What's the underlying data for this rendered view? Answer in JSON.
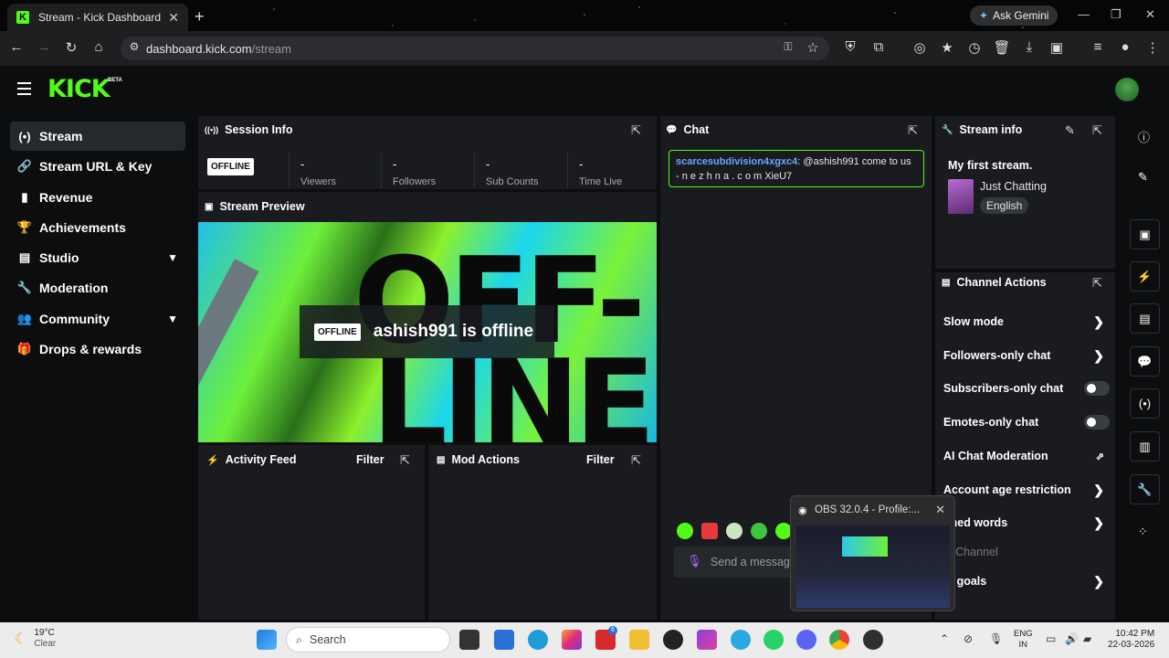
{
  "browser": {
    "tab_title": "Stream - Kick Dashboard",
    "tab_close": "✕",
    "new_tab": "+",
    "gemini_label": "Ask Gemini",
    "url_host": "dashboard.kick.com",
    "url_path": "/stream"
  },
  "app": {
    "logo": "KICK",
    "beta": "BETA"
  },
  "sidebar": {
    "items": [
      {
        "label": "Stream",
        "icon": "(•)"
      },
      {
        "label": "Stream URL & Key",
        "icon": "🔗"
      },
      {
        "label": "Revenue",
        "icon": "▮"
      },
      {
        "label": "Achievements",
        "icon": "🏆"
      },
      {
        "label": "Studio",
        "icon": "▤"
      },
      {
        "label": "Moderation",
        "icon": "🔧"
      },
      {
        "label": "Community",
        "icon": "👥"
      },
      {
        "label": "Drops & rewards",
        "icon": "🎁"
      }
    ]
  },
  "session": {
    "title": "Session Info",
    "status_badge": "OFFLINE",
    "stats": [
      {
        "value": "-",
        "label": "Viewers"
      },
      {
        "value": "-",
        "label": "Followers"
      },
      {
        "value": "-",
        "label": "Sub Counts"
      },
      {
        "value": "-",
        "label": "Time Live"
      }
    ]
  },
  "preview": {
    "title": "Stream Preview",
    "offline_badge": "OFFLINE",
    "offline_text": "ashish991 is offline",
    "art_text_1": "OFF-",
    "art_text_2": "LINE"
  },
  "activity": {
    "title": "Activity Feed",
    "filter": "Filter"
  },
  "mod_actions": {
    "title": "Mod Actions",
    "filter": "Filter"
  },
  "chat": {
    "title": "Chat",
    "message": {
      "user": "scarcesubdivision4xgxc4",
      "text": ": @ashish991 come to us - n e z h n a . c o m XieU7"
    },
    "input_placeholder": "Send a message"
  },
  "stream_info": {
    "title": "Stream info",
    "stream_title": "My first stream.",
    "category": "Just Chatting",
    "language": "English"
  },
  "channel_actions": {
    "title": "Channel Actions",
    "items": [
      {
        "label": "Slow mode",
        "control": "arrow"
      },
      {
        "label": "Followers-only chat",
        "control": "arrow"
      },
      {
        "label": "Subscribers-only chat",
        "control": "toggle"
      },
      {
        "label": "Emotes-only chat",
        "control": "toggle"
      },
      {
        "label": "AI Chat Moderation",
        "control": "external"
      },
      {
        "label": "Account age restriction",
        "control": "arrow"
      },
      {
        "label": "nned words",
        "control": "arrow"
      },
      {
        "label": "st Channel",
        "control": "none"
      },
      {
        "label": "et goals",
        "control": "arrow"
      }
    ]
  },
  "obs_popup": {
    "title": "OBS 32.0.4 - Profile:...",
    "close": "✕"
  },
  "taskbar": {
    "temperature": "19°C",
    "condition": "Clear",
    "search": "Search",
    "lang_top": "ENG",
    "lang_bottom": "IN",
    "time": "10:42 PM",
    "date": "22-03-2026",
    "notif_count": "6"
  },
  "colors": {
    "accent": "#53fc18",
    "panel": "#191b1f",
    "page": "#0b0d0e",
    "chat_user": "#6ba7ff"
  }
}
